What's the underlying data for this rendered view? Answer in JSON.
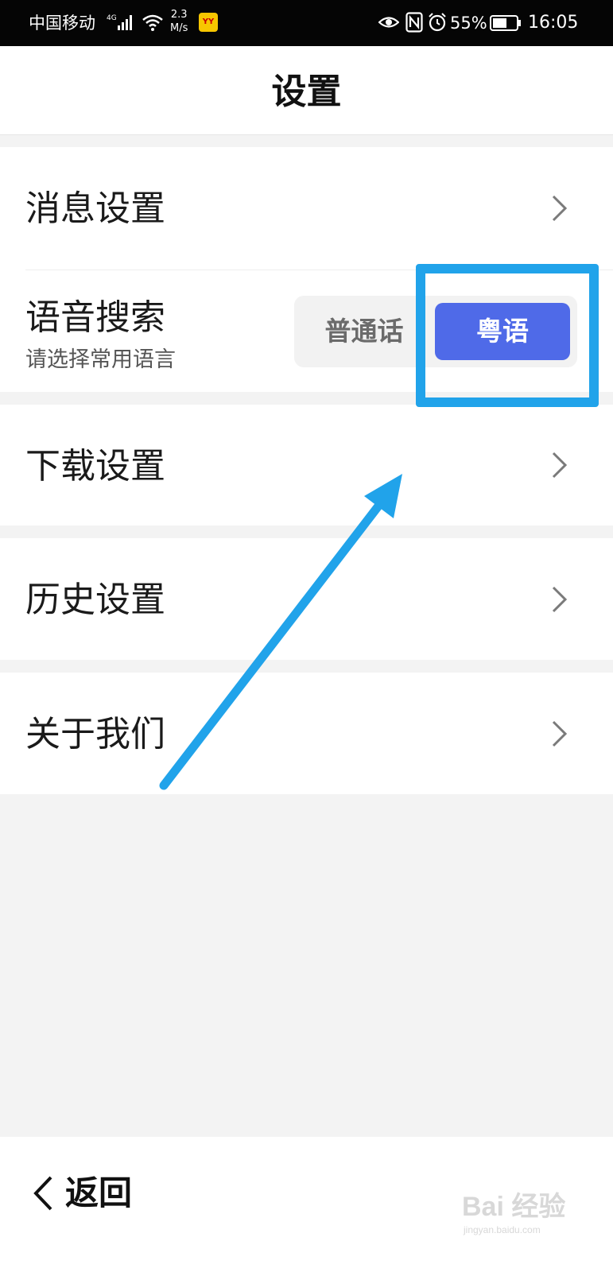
{
  "status_bar": {
    "carrier": "中国移动",
    "network": "4G",
    "speed_value": "2.3",
    "speed_unit": "M/s",
    "app_badge": "YY",
    "battery": "55%",
    "time": "16:05"
  },
  "header": {
    "title": "设置"
  },
  "settings": {
    "message": {
      "label": "消息设置",
      "icon": "chevron-right-icon"
    },
    "voice": {
      "label": "语音搜索",
      "sublabel": "请选择常用语言",
      "options": [
        "普通话",
        "粤语"
      ],
      "selected": "粤语",
      "selected_color": "#4f6ae8"
    },
    "download": {
      "label": "下载设置",
      "icon": "chevron-right-icon"
    },
    "history": {
      "label": "历史设置",
      "icon": "chevron-right-icon"
    },
    "about": {
      "label": "关于我们",
      "icon": "chevron-right-icon"
    }
  },
  "bottom_bar": {
    "back_label": "返回"
  },
  "watermark": {
    "text": "Bai 经验",
    "url": "jingyan.baidu.com"
  },
  "annotation": {
    "color": "#21a3ea"
  }
}
